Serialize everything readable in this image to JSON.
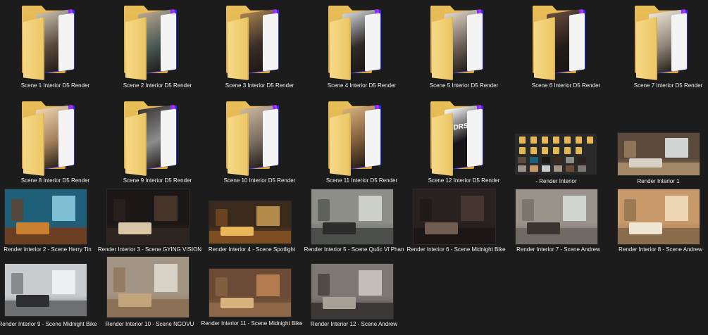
{
  "folders": [
    {
      "name": "Scene 1 Interior D5 Render",
      "tint": "#5a4a3e",
      "accent": "#c9c1b3"
    },
    {
      "name": "Scene 2 Interior D5 Render",
      "tint": "#4a5a54",
      "accent": "#b7a68f"
    },
    {
      "name": "Scene 3 Interior D5 Render",
      "tint": "#3a2e27",
      "accent": "#a8814e"
    },
    {
      "name": "Scene 4 Interior D5 Render",
      "tint": "#2f2a26",
      "accent": "#d1d6dc"
    },
    {
      "name": "Scene 5 Interior D5 Render",
      "tint": "#6b6155",
      "accent": "#dfd5c6"
    },
    {
      "name": "Scene 6 Interior D5 Render",
      "tint": "#241d19",
      "accent": "#6b4d3b"
    },
    {
      "name": "Scene 7 Interior D5 Render",
      "tint": "#8f8576",
      "accent": "#ece4d7"
    },
    {
      "name": "Scene 8 Interior D5 Render",
      "tint": "#a47f59",
      "accent": "#ead5b3"
    },
    {
      "name": "Scene 9 Interior D5 Render",
      "tint": "#8b8d8e",
      "accent": "#3a3633"
    },
    {
      "name": "Scene 10 Interior D5 Render",
      "tint": "#7a6d5f",
      "accent": "#c9b79e"
    },
    {
      "name": "Scene 11 Interior D5 Render",
      "tint": "#7d5a3a",
      "accent": "#d6b07c"
    },
    {
      "name": "Scene 12 Interior D5 Render",
      "tint": "#15151a",
      "accent": "#ffffff",
      "logo": "DRS"
    }
  ],
  "files": [
    {
      "name": "- Render Interior",
      "kind": "contact-sheet"
    },
    {
      "name": "Render Interior 1",
      "bg": "#5b4a3c",
      "win": "#e8ecee",
      "floor": "#a48866",
      "obj": "#d7d0c4"
    },
    {
      "name": "Render Interior 2 - Scene Herry Tin",
      "bg": "#1e5f79",
      "win": "#8fd0e4",
      "floor": "#6b3d23",
      "obj": "#c9802f"
    },
    {
      "name": "Render Interior 3 - Scene GYING VISION",
      "bg": "#1b1716",
      "win": "#4c3a2e",
      "floor": "#2d241f",
      "obj": "#d8c6a6"
    },
    {
      "name": "Render Interior 4 - Scene Spotlight",
      "bg": "#3a2a1c",
      "win": "#c99b52",
      "floor": "#7d4e22",
      "obj": "#e9b65a"
    },
    {
      "name": "Render Interior 5 - Scene Quốc Vĩ Phan",
      "bg": "#8e8e88",
      "win": "#d8dcd2",
      "floor": "#4c4e4c",
      "obj": "#2c2c2c"
    },
    {
      "name": "Render Interior 6 - Scene Midnight Bike",
      "bg": "#2a2220",
      "win": "#4a3a33",
      "floor": "#1c1716",
      "obj": "#705c50"
    },
    {
      "name": "Render Interior 7 - Scene Andrew",
      "bg": "#9a938a",
      "win": "#d9e0dd",
      "floor": "#6f6a63",
      "obj": "#3a3532"
    },
    {
      "name": "Render Interior 8 - Scene Andrew",
      "bg": "#c89a6a",
      "win": "#f2e0c0",
      "floor": "#8a6b4c",
      "obj": "#efe6d4"
    },
    {
      "name": "Render Interior 9 - Scene Midnight Bike",
      "bg": "#c9ccce",
      "win": "#f3f5f6",
      "floor": "#6d6e70",
      "obj": "#2e2e30"
    },
    {
      "name": "Render Interior 10 - Scene NGOVU",
      "bg": "#a39584",
      "win": "#e2ddd2",
      "floor": "#8b7256",
      "obj": "#c4a47c"
    },
    {
      "name": "Render Interior 11 - Scene Midnight Bike",
      "bg": "#6b4b35",
      "win": "#c08655",
      "floor": "#8c6646",
      "obj": "#d9b37d"
    },
    {
      "name": "Render Interior 12 - Scene Andrew",
      "bg": "#7d7772",
      "win": "#cfcac4",
      "floor": "#3b3836",
      "obj": "#a89f95"
    }
  ]
}
